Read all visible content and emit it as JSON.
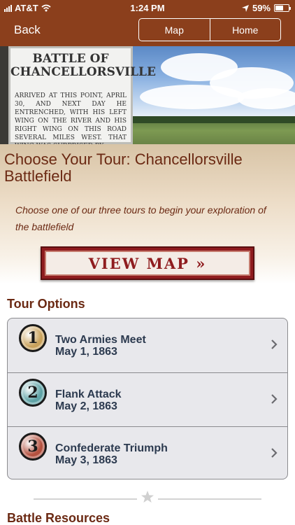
{
  "status_bar": {
    "carrier": "AT&T",
    "time": "1:24 PM",
    "battery": "59%",
    "battery_level": 0.59
  },
  "nav": {
    "back_label": "Back",
    "map_label": "Map",
    "home_label": "Home"
  },
  "hero": {
    "sign_title": "BATTLE OF CHANCELLORSVILLE",
    "sign_text": "ARRIVED AT THIS POINT, APRIL 30, AND NEXT DAY HE ENTRENCHED, WITH HIS LEFT WING ON THE RIVER AND HIS RIGHT WING ON THIS ROAD SEVERAL MILES WEST. THAT WING WAS SURPRISED BY"
  },
  "intro": {
    "title": "Choose Your Tour: Chancellorsville Battlefield",
    "subtitle": "Choose one of our three tours to begin your exploration of the battlefield",
    "view_map_label": "VIEW MAP »"
  },
  "tour_options": {
    "heading": "Tour Options",
    "items": [
      {
        "number": "1",
        "name": "Two Armies Meet",
        "date": "May 1, 1863",
        "badge_color": "#c9a15a"
      },
      {
        "number": "2",
        "name": "Flank Attack",
        "date": "May 2, 1863",
        "badge_color": "#5fa3a6"
      },
      {
        "number": "3",
        "name": "Confederate Triumph",
        "date": "May 3, 1863",
        "badge_color": "#b4513f"
      }
    ]
  },
  "battle_resources": {
    "heading": "Battle Resources"
  }
}
